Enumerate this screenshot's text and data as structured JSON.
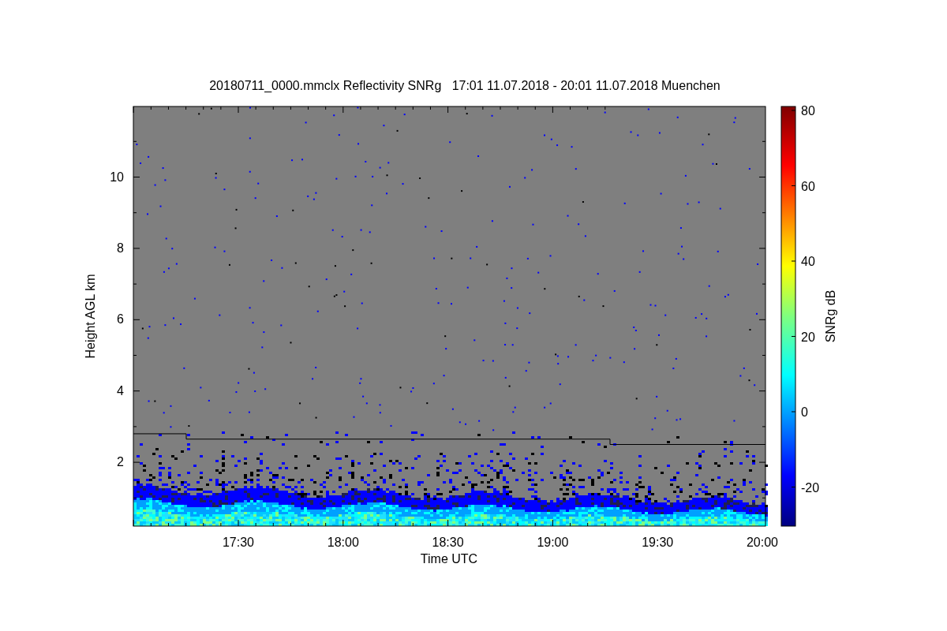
{
  "title": "20180711_0000.mmclx Reflectivity SNRg   17:01 11.07.2018 - 20:01 11.07.2018 Muenchen",
  "y_axis": {
    "label": "Height AGL km",
    "ticks": [
      "10",
      "8",
      "6",
      "4",
      "2"
    ]
  },
  "x_axis": {
    "label": "Time UTC",
    "ticks": [
      "17:30",
      "18:00",
      "18:30",
      "19:00",
      "19:30",
      "20:00"
    ]
  },
  "colorbar": {
    "label": "SNRg dB",
    "ticks": [
      "80",
      "60",
      "40",
      "20",
      "0",
      "-20"
    ]
  }
}
